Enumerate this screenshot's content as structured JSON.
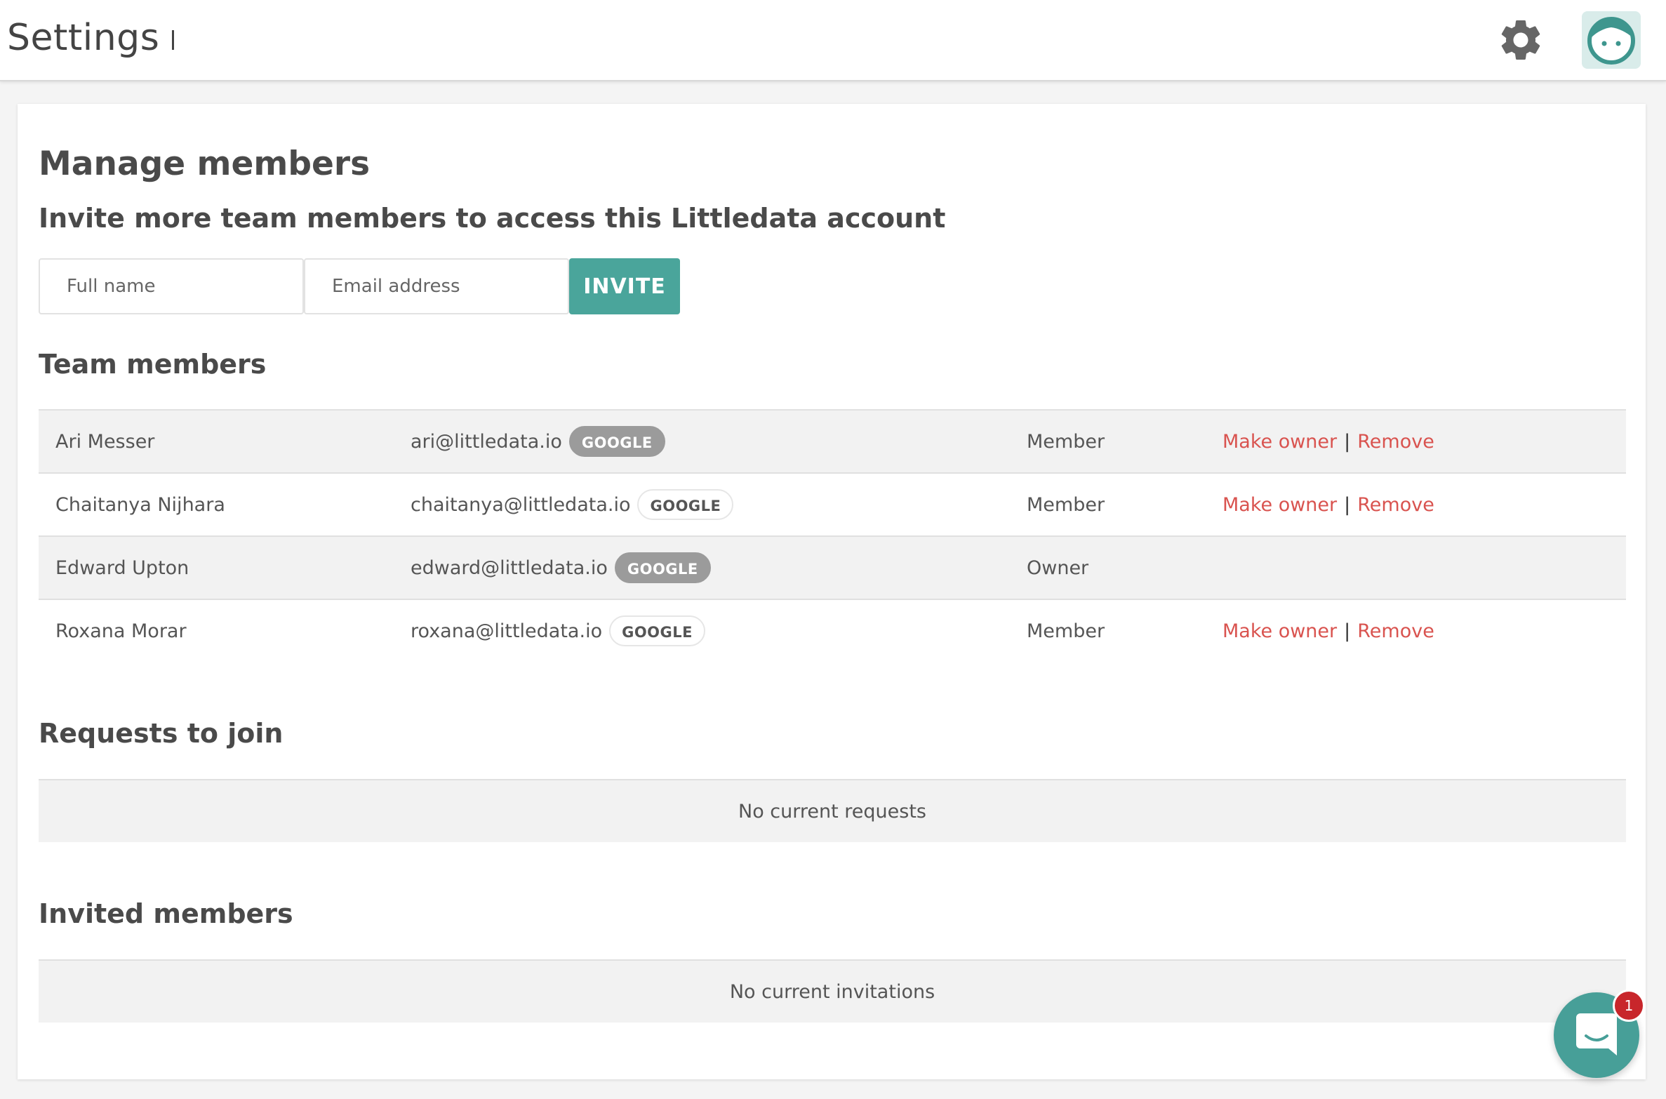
{
  "header": {
    "title": "Settings"
  },
  "manage": {
    "heading": "Manage members",
    "subheading": "Invite more team members to access this Littledata account",
    "name_placeholder": "Full name",
    "email_placeholder": "Email address",
    "invite_label": "INVITE"
  },
  "team": {
    "heading": "Team members",
    "rows": [
      {
        "name": "Ari Messer",
        "email": "ari@littledata.io",
        "badge": "GOOGLE",
        "role": "Member",
        "make_owner": "Make owner",
        "sep": "|",
        "remove": "Remove"
      },
      {
        "name": "Chaitanya Nijhara",
        "email": "chaitanya@littledata.io",
        "badge": "GOOGLE",
        "role": "Member",
        "make_owner": "Make owner",
        "sep": "|",
        "remove": "Remove"
      },
      {
        "name": "Edward Upton",
        "email": "edward@littledata.io",
        "badge": "GOOGLE",
        "role": "Owner"
      },
      {
        "name": "Roxana Morar",
        "email": "roxana@littledata.io",
        "badge": "GOOGLE",
        "role": "Member",
        "make_owner": "Make owner",
        "sep": "|",
        "remove": "Remove"
      }
    ]
  },
  "requests": {
    "heading": "Requests to join",
    "empty": "No current requests"
  },
  "invited": {
    "heading": "Invited members",
    "empty": "No current invitations"
  },
  "chat": {
    "unread_count": "1"
  },
  "colors": {
    "accent": "#4aa59b",
    "link": "#d9534f",
    "badge_gray": "#9b9b9b",
    "notification": "#c8262b"
  },
  "icons": {
    "settings": "gear-icon",
    "profile": "avatar-face-icon",
    "chat": "chat-bubble-icon"
  }
}
